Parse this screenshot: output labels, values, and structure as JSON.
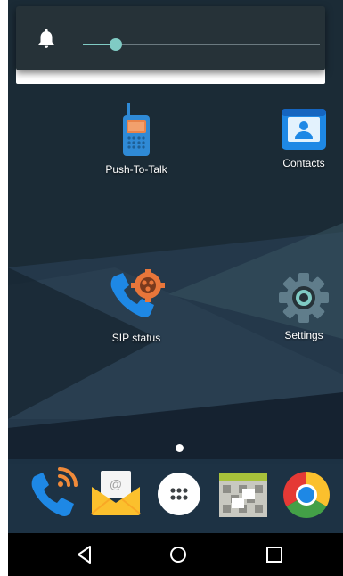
{
  "volume_popup": {
    "icon": "bell-icon",
    "level": 0.14,
    "accent": "#80cbc4"
  },
  "home": {
    "apps": [
      {
        "label": "Push-To-Talk",
        "icon": "walkie-talkie-icon"
      },
      {
        "label": "Contacts",
        "icon": "contacts-icon"
      },
      {
        "label": "SIP status",
        "icon": "sip-phone-gear-icon"
      },
      {
        "label": "Settings",
        "icon": "gear-icon"
      }
    ],
    "page_indicator": {
      "pages": 1,
      "current": 1
    }
  },
  "dock": {
    "items": [
      {
        "name": "wifi-phone-icon"
      },
      {
        "name": "email-icon"
      },
      {
        "name": "app-drawer-icon"
      },
      {
        "name": "gallery-icon"
      },
      {
        "name": "chrome-icon"
      }
    ]
  },
  "navbar": {
    "buttons": [
      "back-icon",
      "home-icon",
      "recents-icon"
    ]
  },
  "colors": {
    "wallpaper": "#1a2a35",
    "navbar": "#000000"
  }
}
